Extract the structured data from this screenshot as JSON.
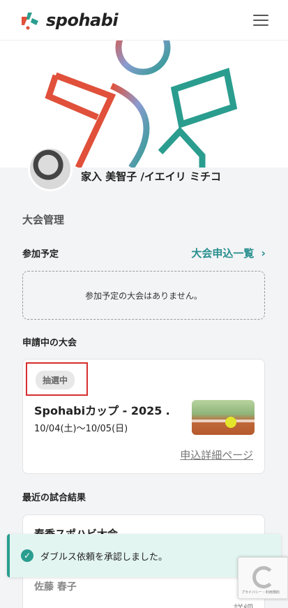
{
  "header": {
    "logo_text": "spohabi",
    "menu_icon": "hamburger-menu-icon"
  },
  "profile": {
    "name": "家入 美智子 /イエイリ ミチコ"
  },
  "tournament": {
    "section_title": "大会管理",
    "planned": {
      "title": "参加予定",
      "link_label": "大会申込一覧",
      "empty_message": "参加予定の大会はありません。"
    },
    "applying": {
      "title": "申請中の大会",
      "status_badge": "抽選中",
      "event_name": "Spohabiカップ - 2025 …",
      "event_dates": "10/04(土)〜10/05(日)",
      "detail_link": "申込詳細ページ"
    },
    "recent_results": {
      "title": "最近の試合結果",
      "event_name": "春季スポハビ大会",
      "player": "佐藤 春子",
      "detail": "詳細"
    }
  },
  "toast": {
    "message": "ダブルス依頼を承認しました。"
  },
  "recaptcha": {
    "text": "プライバシー・利用規約"
  },
  "colors": {
    "accent": "#2a8f8f",
    "brand_red": "#e0503a",
    "brand_teal": "#2a9d8f",
    "highlight_border": "#d62e2e"
  }
}
